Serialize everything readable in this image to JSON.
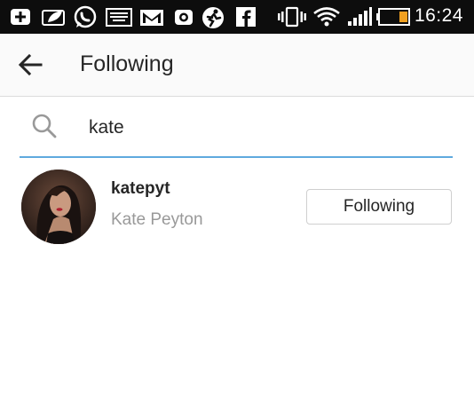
{
  "status_bar": {
    "time": "16:24",
    "icons": [
      "add-icon",
      "image-icon",
      "whatsapp-icon",
      "keyboard-icon",
      "gmail-icon",
      "camera-icon",
      "sport-app-icon",
      "facebook-icon",
      "vibrate-icon",
      "wifi-icon",
      "signal-icon",
      "battery-icon"
    ],
    "battery_level": 0.3
  },
  "header": {
    "back_icon": "arrow-back-icon",
    "title": "Following"
  },
  "search": {
    "icon": "search-icon",
    "value": "kate",
    "underline_color": "#5fa9de"
  },
  "results": [
    {
      "username": "katepyt",
      "full_name": "Kate Peyton",
      "button_label": "Following"
    }
  ]
}
